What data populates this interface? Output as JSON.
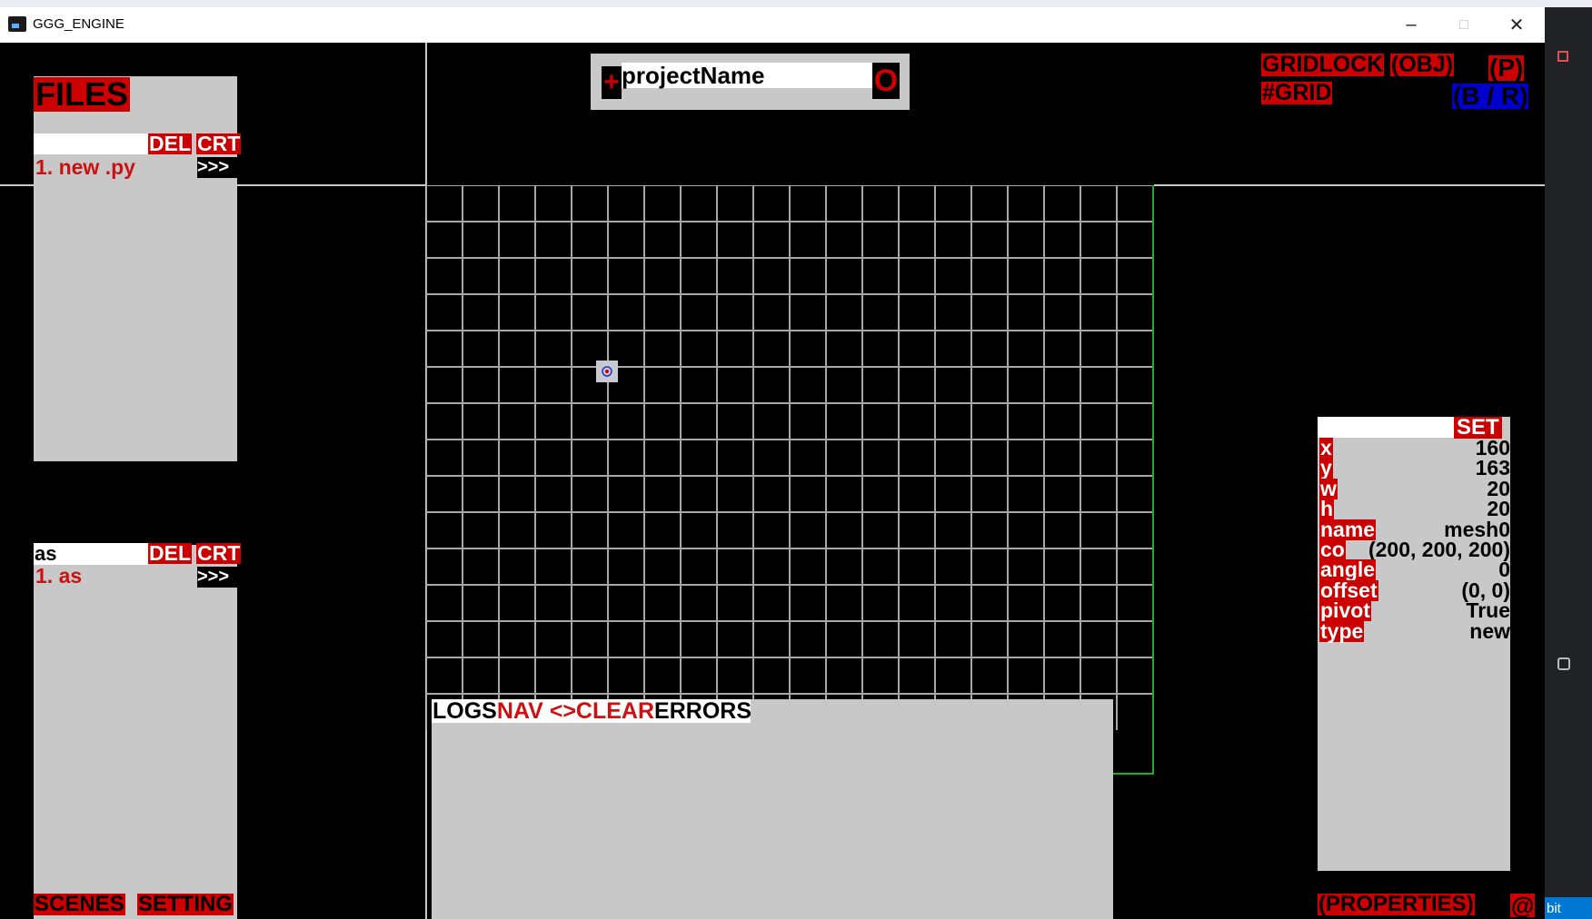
{
  "window": {
    "title": "GGG_ENGINE",
    "minimize_icon": "minimize-icon",
    "maximize_icon": "maximize-icon",
    "close_icon": "close-icon"
  },
  "files_panel": {
    "title": "FILES",
    "input_value": "",
    "del_label": "DEL",
    "crt_label": "CRT",
    "items": [
      {
        "label": "1. new .py",
        "open": ">>>"
      }
    ]
  },
  "scenes_panel": {
    "input_value": "as",
    "del_label": "DEL",
    "crt_label": "CRT",
    "items": [
      {
        "label": "1. as",
        "open": ">>>"
      }
    ]
  },
  "bottom_left": {
    "scenes_label": "SCENES",
    "setting_label": "SETTING"
  },
  "project": {
    "add_icon": "+",
    "name": "projectName",
    "open_icon": "O"
  },
  "top_right": {
    "gridlock": "GRIDLOCK",
    "obj": "(OBJ)",
    "p": "(P)",
    "grid": "#GRID",
    "br": "(B / R)"
  },
  "logs": {
    "logs_label": "LOGS",
    "nav_label": "NAV <>",
    "clear_label": "CLEAR",
    "errors_label": "ERRORS"
  },
  "properties": {
    "set_label": "SET",
    "input_value": "",
    "rows": [
      {
        "key": "x",
        "value": "160"
      },
      {
        "key": "y",
        "value": "163"
      },
      {
        "key": "w",
        "value": "20"
      },
      {
        "key": "h",
        "value": "20"
      },
      {
        "key": "name",
        "value": "mesh0"
      },
      {
        "key": "co",
        "value": "(200, 200, 200)"
      },
      {
        "key": "angle",
        "value": "0"
      },
      {
        "key": "offset",
        "value": "(0, 0)"
      },
      {
        "key": "pivot",
        "value": "True"
      },
      {
        "key": "type",
        "value": "new"
      }
    ],
    "footer_label": "(PROPERTIES)",
    "at_label": "@"
  },
  "side_strip": {
    "bit_label": "bit"
  },
  "colors": {
    "accent_red": "#cc0000",
    "panel_gray": "#c8c8c8",
    "grid_line": "#a8a8a8",
    "blue": "#0000cc",
    "green_border": "#22aa22"
  }
}
